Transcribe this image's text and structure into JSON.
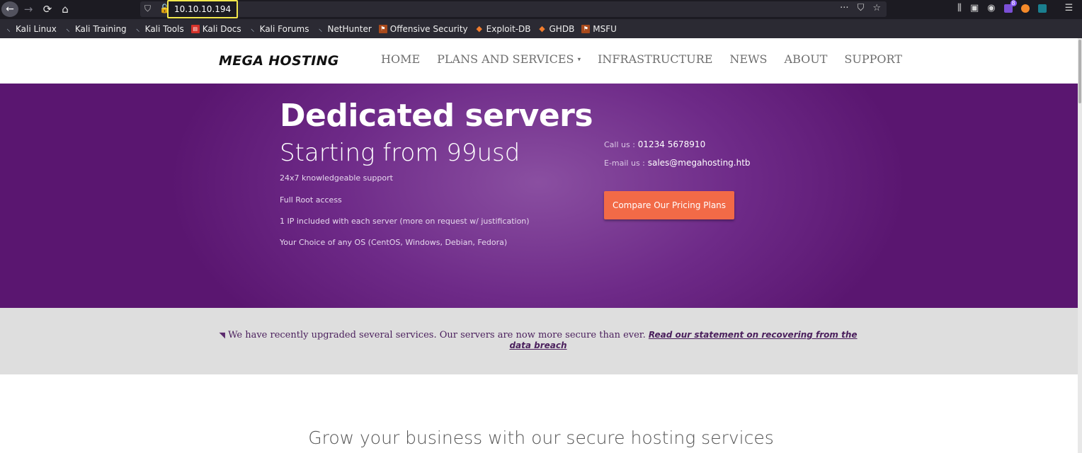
{
  "browser": {
    "url": "10.10.10.194",
    "nav": {
      "back": "←",
      "forward": "→",
      "reload": "⟳",
      "home": "⌂"
    },
    "url_actions": [
      "···",
      "⛉",
      "☆"
    ],
    "bookmarks": [
      {
        "label": "Kali Linux",
        "icon": "dragon-icon"
      },
      {
        "label": "Kali Training",
        "icon": "dragon-icon"
      },
      {
        "label": "Kali Tools",
        "icon": "dragon-icon"
      },
      {
        "label": "Kali Docs",
        "icon": "docs-icon"
      },
      {
        "label": "Kali Forums",
        "icon": "dragon-icon"
      },
      {
        "label": "NetHunter",
        "icon": "dragon-icon"
      },
      {
        "label": "Offensive Security",
        "icon": "offsec-icon"
      },
      {
        "label": "Exploit-DB",
        "icon": "exploit-icon"
      },
      {
        "label": "GHDB",
        "icon": "exploit-icon"
      },
      {
        "label": "MSFU",
        "icon": "offsec-icon"
      }
    ],
    "extension_badge": "8"
  },
  "header": {
    "logo": "MEGA HOSTING",
    "nav": [
      "HOME",
      "PLANS AND SERVICES",
      "INFRASTRUCTURE",
      "NEWS",
      "ABOUT",
      "SUPPORT"
    ]
  },
  "hero": {
    "title": "Dedicated servers",
    "subtitle": "Starting from 99usd",
    "features": [
      "24x7 knowledgeable support",
      "Full Root access",
      "1 IP included with each server (more on request w/ justification)",
      "Your Choice of any OS (CentOS, Windows, Debian, Fedora)"
    ],
    "call_label": "Call us :",
    "phone": "01234 5678910",
    "email_label": "E-mail us :",
    "email": "sales@megahosting.htb",
    "cta": "Compare Our Pricing Plans"
  },
  "announcement": {
    "text": "We have recently upgraded several services. Our servers are now more secure than ever.",
    "link": "Read our statement on recovering from the data breach"
  },
  "section": {
    "heading": "Grow your business with our secure hosting services"
  },
  "colors": {
    "hero_purple": "#6e2a88",
    "cta_orange": "#f26a47",
    "announce_bg": "#dedede"
  }
}
